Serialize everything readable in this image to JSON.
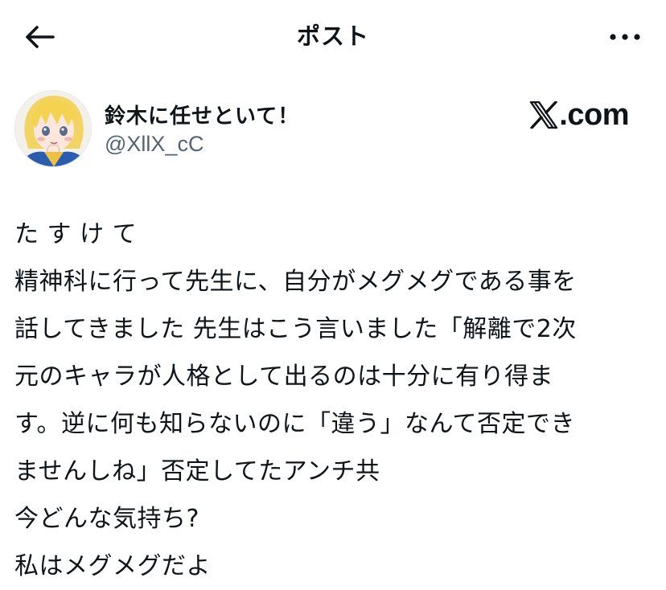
{
  "topbar": {
    "back_icon": "arrow-left-icon",
    "title": "ポスト",
    "more_icon": "more-horizontal-icon"
  },
  "author": {
    "display_name": "鈴木に任せといて！",
    "handle": "@XllX_cC",
    "avatar": "anime-character-avatar"
  },
  "brand": {
    "text": ".com",
    "icon": "x-logo-icon"
  },
  "post": {
    "lines": [
      "た す け て",
      "精神科に行って先生に、自分がメグメグである事を",
      "話してきました 先生はこう言いました「解離で2次",
      "元のキャラが人格として出るのは十分に有り得ま",
      "す。逆に何も知らないのに「違う」なんて否定でき",
      "ませんしね」否定してたアンチ共",
      "今どんな気持ち?",
      "私はメグメグだよ"
    ]
  },
  "colors": {
    "text": "#0f1419",
    "secondary": "#536471",
    "background": "#ffffff"
  }
}
